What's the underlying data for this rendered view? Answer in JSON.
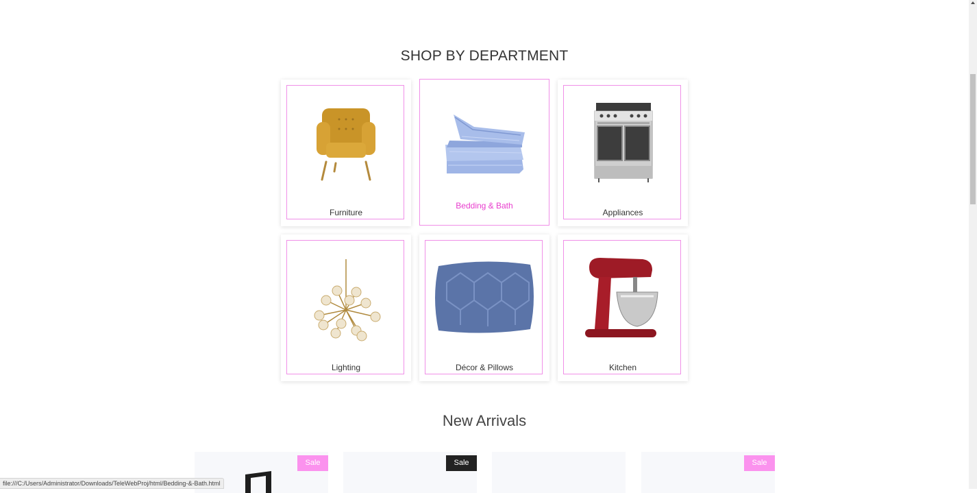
{
  "departments": {
    "title": "SHOP BY DEPARTMENT",
    "items": [
      {
        "label": "Furniture",
        "icon": "armchair-icon"
      },
      {
        "label": "Bedding & Bath",
        "icon": "folded-sheets-icon"
      },
      {
        "label": "Appliances",
        "icon": "range-oven-icon"
      },
      {
        "label": "Lighting",
        "icon": "chandelier-icon"
      },
      {
        "label": "Décor & Pillows",
        "icon": "pillow-icon"
      },
      {
        "label": "Kitchen",
        "icon": "stand-mixer-icon"
      }
    ]
  },
  "arrivals": {
    "title": "New Arrivals",
    "products": [
      {
        "badge": "Sale"
      },
      {
        "badge": "Sale"
      },
      {
        "badge": ""
      },
      {
        "badge": "Sale"
      }
    ]
  },
  "status_bar": {
    "url": "file:///C:/Users/Administrator/Downloads/TeleWebProj/html/Bedding-&-Bath.html"
  },
  "colors": {
    "accent": "#e83ccd",
    "card_border": "#f08fe8",
    "sale_badge": "#fb92ee",
    "sale_badge_dark": "#222222"
  }
}
